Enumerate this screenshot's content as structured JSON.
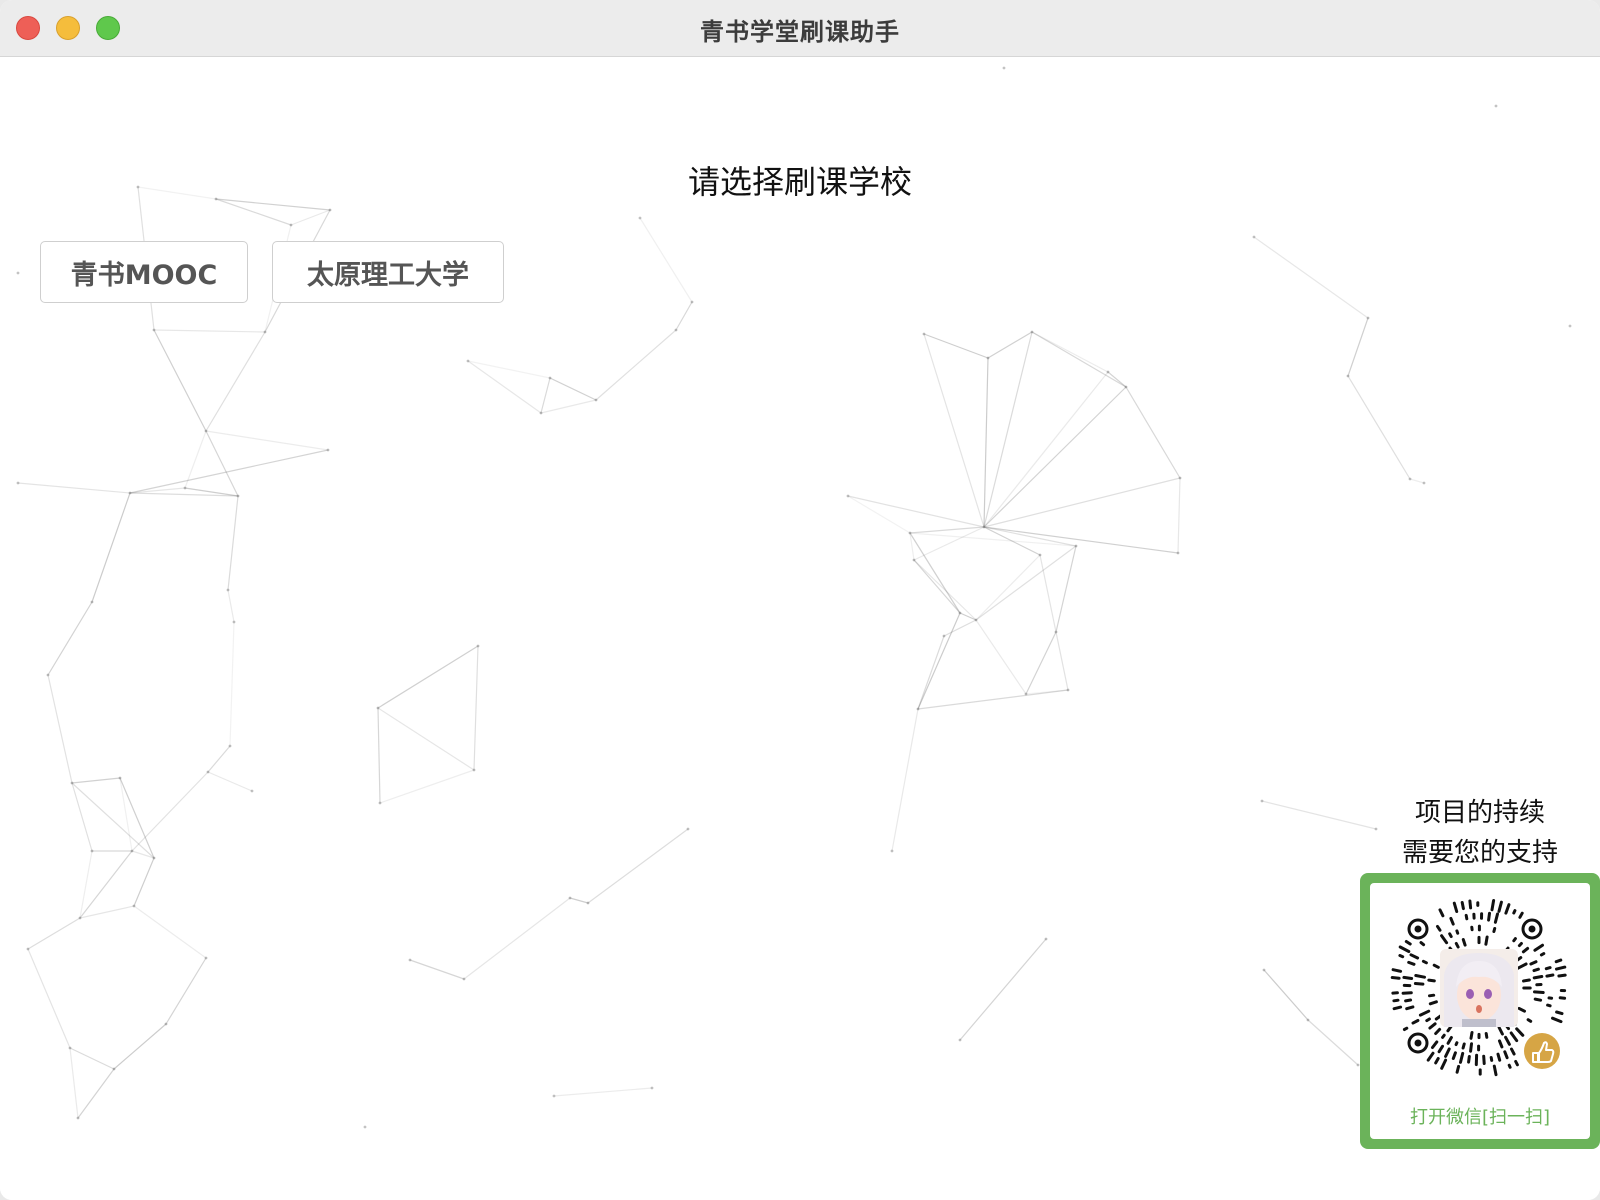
{
  "window": {
    "title": "青书学堂刷课助手"
  },
  "main": {
    "heading": "请选择刷课学校",
    "schools": [
      {
        "label": "青书MOOC"
      },
      {
        "label": "太原理工大学"
      }
    ]
  },
  "support": {
    "line1": "项目的持续",
    "line2": "需要您的支持",
    "qr_caption": "打开微信[扫一扫]",
    "accent_color": "#6bb35a"
  },
  "colors": {
    "close": "#ee5f57",
    "minimize": "#f5bd3c",
    "maximize": "#5fc84c"
  }
}
